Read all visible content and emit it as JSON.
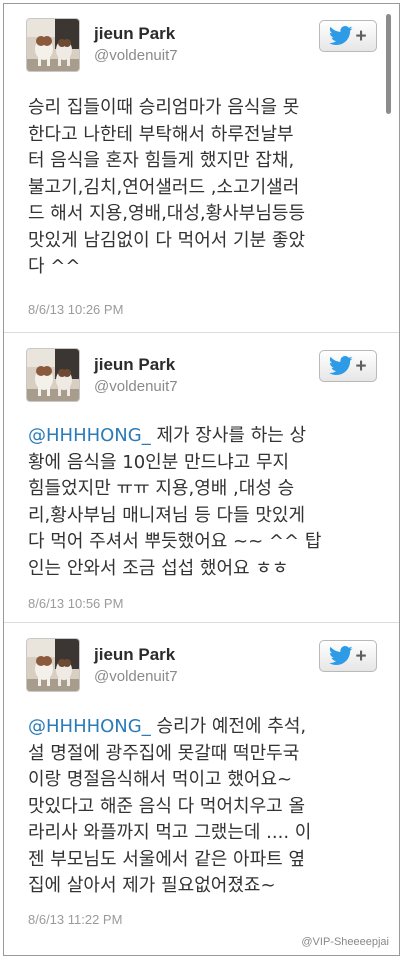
{
  "accent_color": "#2b7bb9",
  "tweets": [
    {
      "user": {
        "name": "jieun Park",
        "handle": "@voldenuit7",
        "avatar_icon": "avatar-dogs-photo"
      },
      "follow": {
        "icon": "twitter-bird-icon",
        "label": "+"
      },
      "text_lines": [
        "승리 집들이때 승리엄마가 음식을 못",
        "한다고 나한테 부탁해서 하루전날부",
        "터 음식을 혼자 힘들게 했지만 잡채,",
        "불고기,김치,연어샐러드 ,소고기샐러",
        "드 해서 지용,영배,대성,황사부님등등",
        "맛있게 남김없이 다 먹어서 기분 좋았",
        "다 ^^"
      ],
      "timestamp": "8/6/13 10:26 PM"
    },
    {
      "user": {
        "name": "jieun Park",
        "handle": "@voldenuit7",
        "avatar_icon": "avatar-dogs-photo"
      },
      "follow": {
        "icon": "twitter-bird-icon",
        "label": "+"
      },
      "mention": "@HHHHONG_",
      "text_first_rest": " 제가 장사를 하는 상",
      "text_lines": [
        "황에 음식을 10인분 만드냐고 무지",
        "힘들었지만 ㅠㅠ 지용,영배 ,대성 승",
        "리,황사부님 매니져님 등 다들 맛있게",
        "다 먹어 주셔서 뿌듯했어요 ~~ ^^ 탑",
        "인는 안와서 조금 섭섭 했어요 ㅎㅎ"
      ],
      "timestamp": "8/6/13 10:56 PM"
    },
    {
      "user": {
        "name": "jieun Park",
        "handle": "@voldenuit7",
        "avatar_icon": "avatar-dogs-photo"
      },
      "follow": {
        "icon": "twitter-bird-icon",
        "label": "+"
      },
      "mention": "@HHHHONG_",
      "text_first_rest": " 승리가 예전에 추석,",
      "text_lines": [
        "설 명절에 광주집에 못갈때 떡만두국",
        "이랑 명절음식해서 먹이고 했어요~",
        "맛있다고 해준 음식 다 먹어치우고 올",
        "라리사 와플까지 먹고 그랬는데 .... 이",
        "젠 부모님도 서울에서 같은 아파트 옆",
        "집에 살아서 제가 필요없어졌죠~"
      ],
      "timestamp": "8/6/13 11:22 PM"
    }
  ],
  "watermark": "@VIP-Sheeeepjai"
}
